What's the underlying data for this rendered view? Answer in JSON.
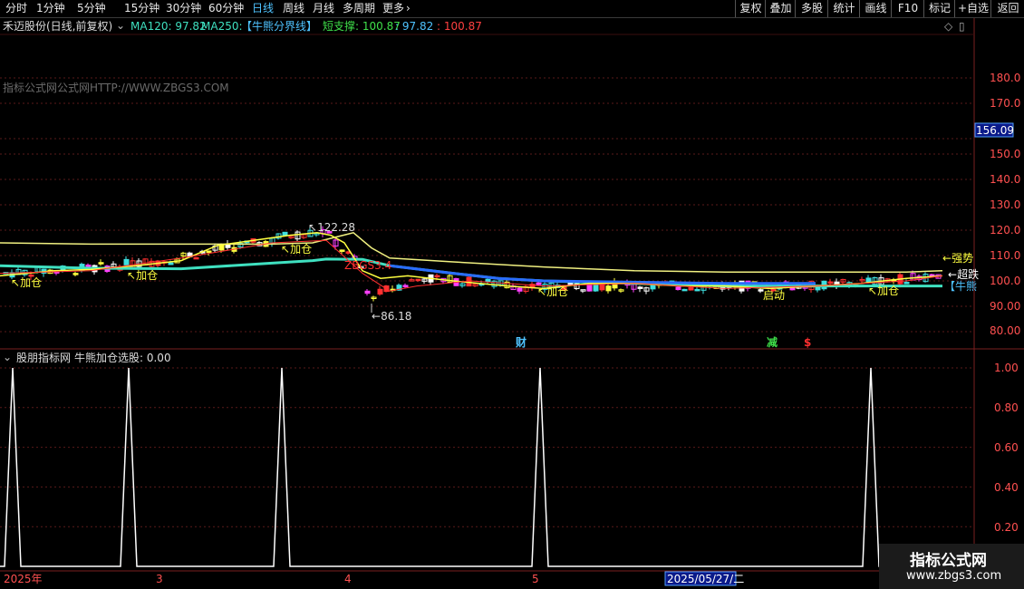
{
  "toolbar": {
    "periods": [
      "分时",
      "1分钟",
      "5分钟",
      "15分钟",
      "30分钟",
      "60分钟",
      "日线",
      "周线",
      "月线",
      "多周期",
      "更多"
    ],
    "active_period": "日线",
    "more_arrow": "›",
    "right_buttons": [
      "复权",
      "叠加",
      "多股",
      "统计",
      "画线",
      "F10",
      "标记",
      "+自选",
      "返回"
    ]
  },
  "main_panel": {
    "stock_title": "禾迈股份(日线,前复权)",
    "indicators": [
      {
        "label": "MA120: 97.82",
        "color": "#3fe0c0"
      },
      {
        "label": "MA250:",
        "color": "#3fe0c0"
      },
      {
        "label": "【牛熊分界线】",
        "color": "#4fc3ff"
      },
      {
        "label": "短支撑: 100.87",
        "color": "#3fe04a"
      },
      {
        "label": ": 97.82",
        "color": "#4fc3ff"
      },
      {
        "label": ": 100.87",
        "color": "#ff4040"
      }
    ],
    "watermark_text": "指标公式网公式网HTTP://WWW.ZBGS3.COM",
    "price_axis_ticks": [
      "180.0",
      "170.0",
      "156.09",
      "150.0",
      "140.0",
      "130.0",
      "120.0",
      "110.0",
      "100.0",
      "90.00",
      "80.00"
    ],
    "current_price_badge": "156.09",
    "annotations": {
      "high": "122.28",
      "low": "86.18",
      "zbgs": "ZBGS3.4",
      "add_position": "加仓",
      "start": "启动",
      "strong_trend": "强势",
      "super": "超跌",
      "bull_line": "【牛熊",
      "marker_cai": "财",
      "marker_jian": "减",
      "marker_s": "$"
    }
  },
  "sub_panel": {
    "title": "股朋指标网",
    "indicator_label": "牛熊加仓选股: 0.00",
    "axis_ticks": [
      "1.00",
      "0.80",
      "0.60",
      "0.40",
      "0.20"
    ],
    "signal_values": [
      0,
      1,
      0,
      1,
      0,
      1,
      0,
      1,
      0,
      1,
      0
    ]
  },
  "time_axis": {
    "labels": [
      "2025年",
      "3",
      "4",
      "5"
    ],
    "cursor_date": "2025/05/27/二"
  },
  "site_watermark": {
    "line1": "指标公式网",
    "line2": "www.zbgs3.com"
  },
  "chart_data": {
    "type": "line",
    "ylim": [
      75,
      195
    ],
    "series": [
      {
        "name": "MA250",
        "color": "#f0f080",
        "points": [
          [
            0,
            115
          ],
          [
            100,
            114.5
          ],
          [
            200,
            114.5
          ],
          [
            300,
            114.5
          ],
          [
            345,
            115
          ],
          [
            390,
            119
          ],
          [
            410,
            113
          ],
          [
            430,
            109
          ],
          [
            500,
            107.5
          ],
          [
            600,
            105.5
          ],
          [
            700,
            104
          ],
          [
            800,
            103.5
          ],
          [
            900,
            103.5
          ],
          [
            1000,
            103.5
          ],
          [
            1040,
            104
          ]
        ]
      },
      {
        "name": "MA120",
        "color": "#3fe0c0",
        "points": [
          [
            0,
            106
          ],
          [
            100,
            105
          ],
          [
            200,
            104.8
          ],
          [
            300,
            107
          ],
          [
            345,
            108
          ],
          [
            360,
            108.6
          ],
          [
            400,
            108.5
          ],
          [
            430,
            106
          ],
          [
            500,
            103
          ],
          [
            550,
            101
          ],
          [
            600,
            100
          ],
          [
            700,
            99
          ],
          [
            800,
            98
          ],
          [
            900,
            98
          ],
          [
            1000,
            98
          ],
          [
            1040,
            98
          ]
        ]
      },
      {
        "name": "牛熊分界线",
        "color": "#2a6cff",
        "points": [
          [
            430,
            106
          ],
          [
            500,
            103
          ],
          [
            550,
            101
          ],
          [
            600,
            100
          ],
          [
            700,
            99.5
          ],
          [
            800,
            99
          ],
          [
            900,
            99
          ]
        ]
      },
      {
        "name": "短支撑",
        "color": "#ffff40",
        "points": [
          [
            0,
            102
          ],
          [
            60,
            104
          ],
          [
            100,
            104.5
          ],
          [
            150,
            106
          ],
          [
            200,
            108
          ],
          [
            240,
            114
          ],
          [
            280,
            116
          ],
          [
            320,
            118
          ],
          [
            350,
            119
          ],
          [
            365,
            118
          ],
          [
            380,
            115
          ],
          [
            400,
            104
          ],
          [
            420,
            101
          ],
          [
            450,
            102
          ],
          [
            500,
            100
          ],
          [
            560,
            98
          ],
          [
            600,
            97
          ],
          [
            650,
            99
          ],
          [
            700,
            99
          ],
          [
            750,
            98
          ],
          [
            800,
            98
          ],
          [
            850,
            97
          ],
          [
            900,
            98
          ],
          [
            950,
            99
          ],
          [
            1000,
            101
          ],
          [
            1040,
            102
          ]
        ]
      }
    ]
  }
}
